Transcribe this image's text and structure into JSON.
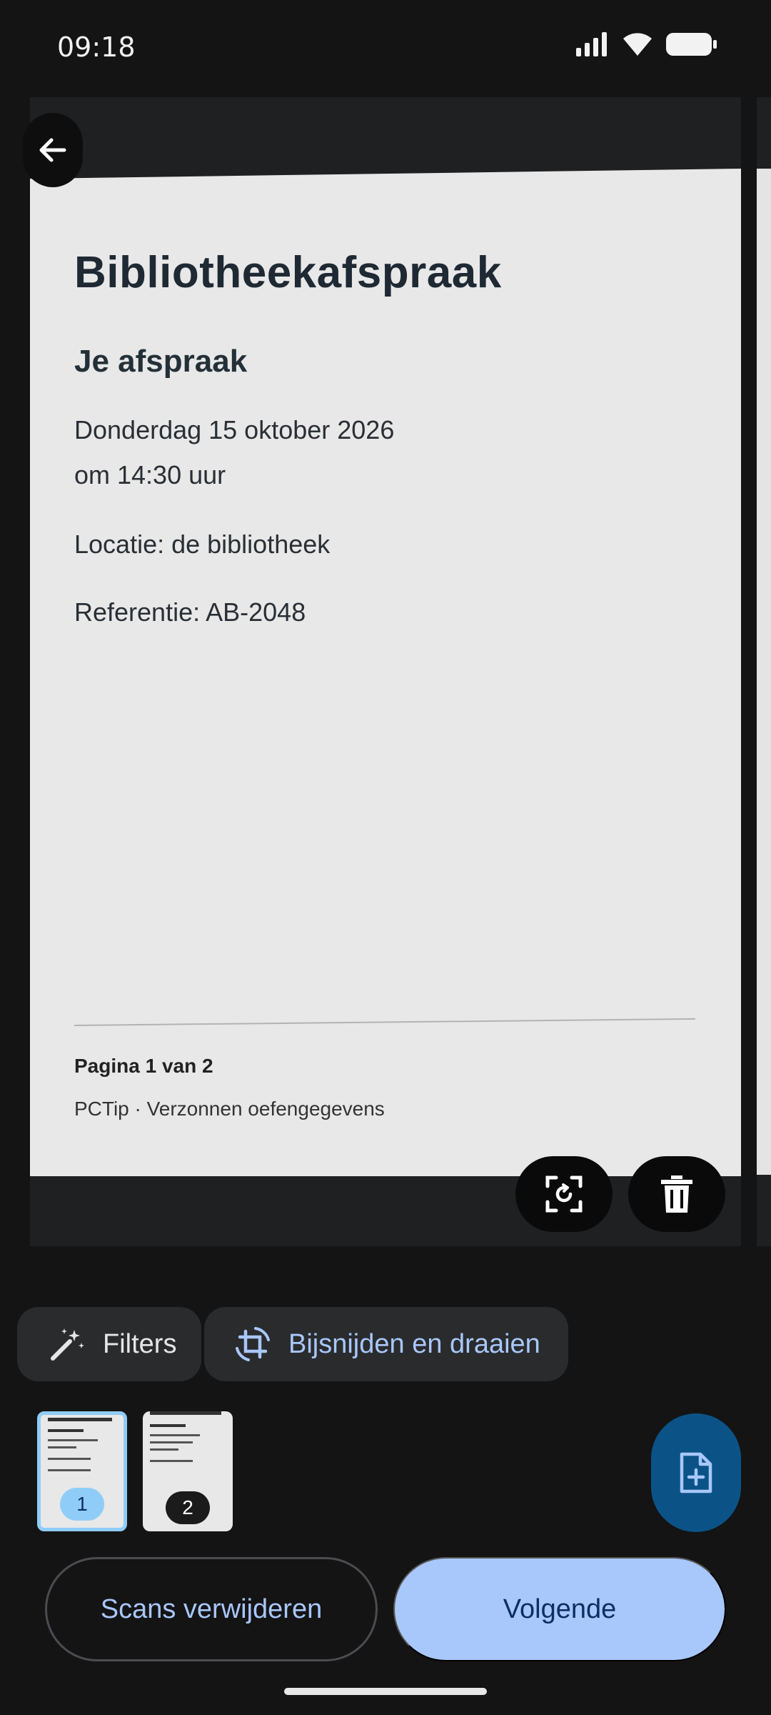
{
  "status_bar": {
    "time": "09:18"
  },
  "document": {
    "title": "Bibliotheekafspraak",
    "heading": "Je afspraak",
    "date_line": "Donderdag 15 oktober 2026",
    "time_line": "om 14:30 uur",
    "location": "Locatie: de bibliotheek",
    "reference": "Referentie: AB-2048",
    "page_number": "Pagina 1 van 2",
    "footer": "PCTip · Verzonnen oefengegevens"
  },
  "toolbar": {
    "filters_label": "Filters",
    "crop_label": "Bijsnijden en draaien"
  },
  "thumbnails": [
    {
      "number": "1",
      "selected": true
    },
    {
      "number": "2",
      "selected": false
    }
  ],
  "actions": {
    "delete_scans_label": "Scans verwijderen",
    "next_label": "Volgende"
  },
  "colors": {
    "accent": "#a8c7fa",
    "selected_thumb": "#8fcdf8",
    "add_button": "#0b5387"
  },
  "icons": [
    "back-arrow-icon",
    "retake-icon",
    "trash-icon",
    "magic-wand-icon",
    "crop-rotate-icon",
    "add-page-icon",
    "signal-icon",
    "wifi-icon",
    "battery-icon"
  ]
}
